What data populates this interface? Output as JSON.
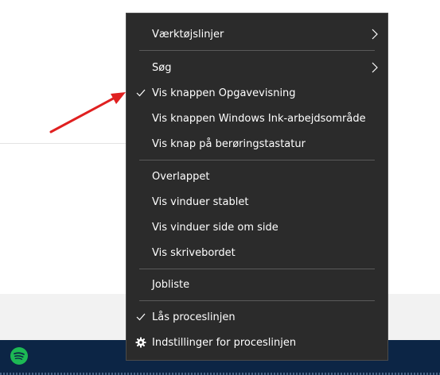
{
  "menu": {
    "items": [
      {
        "label": "Værktøjslinjer",
        "has_submenu": true,
        "checked": false
      },
      {
        "label": "Søg",
        "has_submenu": true,
        "checked": false
      },
      {
        "label": "Vis knappen Opgavevisning",
        "has_submenu": false,
        "checked": true
      },
      {
        "label": "Vis knappen Windows Ink-arbejdsområde",
        "has_submenu": false,
        "checked": false
      },
      {
        "label": "Vis knap på berøringstastatur",
        "has_submenu": false,
        "checked": false
      },
      {
        "label": "Overlappet",
        "has_submenu": false,
        "checked": false
      },
      {
        "label": "Vis vinduer stablet",
        "has_submenu": false,
        "checked": false
      },
      {
        "label": "Vis vinduer side om side",
        "has_submenu": false,
        "checked": false
      },
      {
        "label": "Vis skrivebordet",
        "has_submenu": false,
        "checked": false
      },
      {
        "label": "Jobliste",
        "has_submenu": false,
        "checked": false
      },
      {
        "label": "Lås proceslinjen",
        "has_submenu": false,
        "checked": true
      },
      {
        "label": "Indstillinger for proceslinjen",
        "has_submenu": false,
        "checked": false,
        "icon": "gear-icon"
      }
    ]
  },
  "colors": {
    "menu_background": "#2b2b2b",
    "taskbar": "#0c2545",
    "annotation_arrow": "#e02020",
    "spotify": "#1db954"
  },
  "icons": {
    "taskbar_app": "spotify-icon",
    "annotation": "red-arrow-icon"
  }
}
